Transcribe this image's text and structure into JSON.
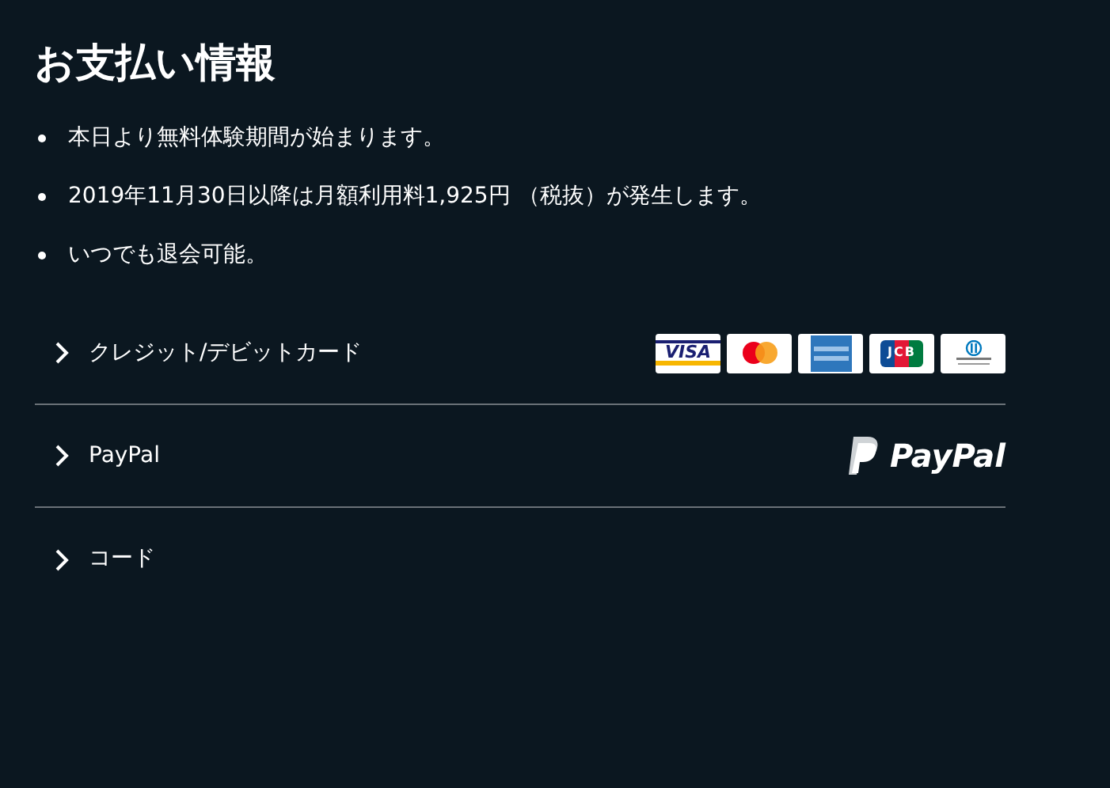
{
  "title": "お支払い情報",
  "notes": [
    "本日より無料体験期間が始まります。",
    "2019年11月30日以降は月額利用料1,925円 （税抜）が発生します。",
    "いつでも退会可能。"
  ],
  "methods": [
    {
      "label": "クレジット/デビットカード",
      "expanded": false,
      "kind": "cards",
      "cards": [
        {
          "kind": "visa",
          "text": "VISA"
        },
        {
          "kind": "mastercard"
        },
        {
          "kind": "amex"
        },
        {
          "kind": "jcb",
          "text": "JCB"
        },
        {
          "kind": "diners"
        }
      ]
    },
    {
      "label": "PayPal",
      "expanded": false,
      "kind": "paypal",
      "logo_text": "PayPal"
    },
    {
      "label": "コード",
      "expanded": false,
      "kind": "plain"
    }
  ]
}
